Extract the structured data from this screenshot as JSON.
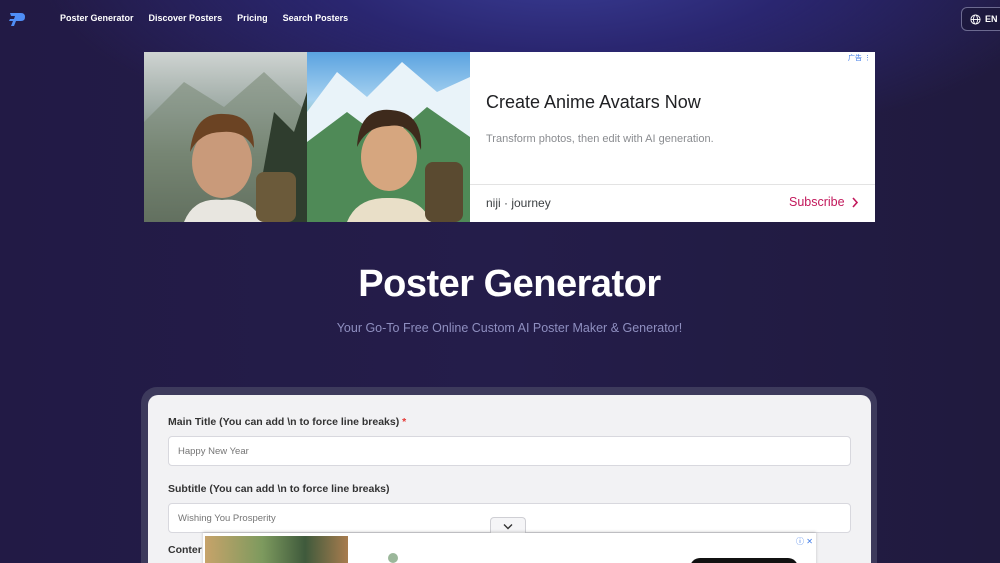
{
  "nav": {
    "links": [
      "Poster Generator",
      "Discover Posters",
      "Pricing",
      "Search Posters"
    ],
    "language": "EN",
    "accent": "#4f8df5"
  },
  "ad": {
    "title": "Create Anime Avatars Now",
    "description": "Transform photos, then edit with AI generation.",
    "brand": "niji · journey",
    "cta": "Subscribe",
    "badge": "广告 ⋮",
    "cta_color": "#c2185b"
  },
  "hero": {
    "title": "Poster Generator",
    "subtitle": "Your Go-To Free Online Custom AI Poster Maker & Generator!"
  },
  "form": {
    "main_title_label": "Main Title (You can add \\n to force line breaks)",
    "required_mark": "*",
    "main_title_placeholder": "Happy New Year",
    "subtitle_label": "Subtitle (You can add \\n to force line breaks)",
    "subtitle_placeholder": "Wishing You Prosperity",
    "content_label_partial": "Conter"
  },
  "bottom_ad": {
    "info_icon": "ⓘ ✕"
  }
}
